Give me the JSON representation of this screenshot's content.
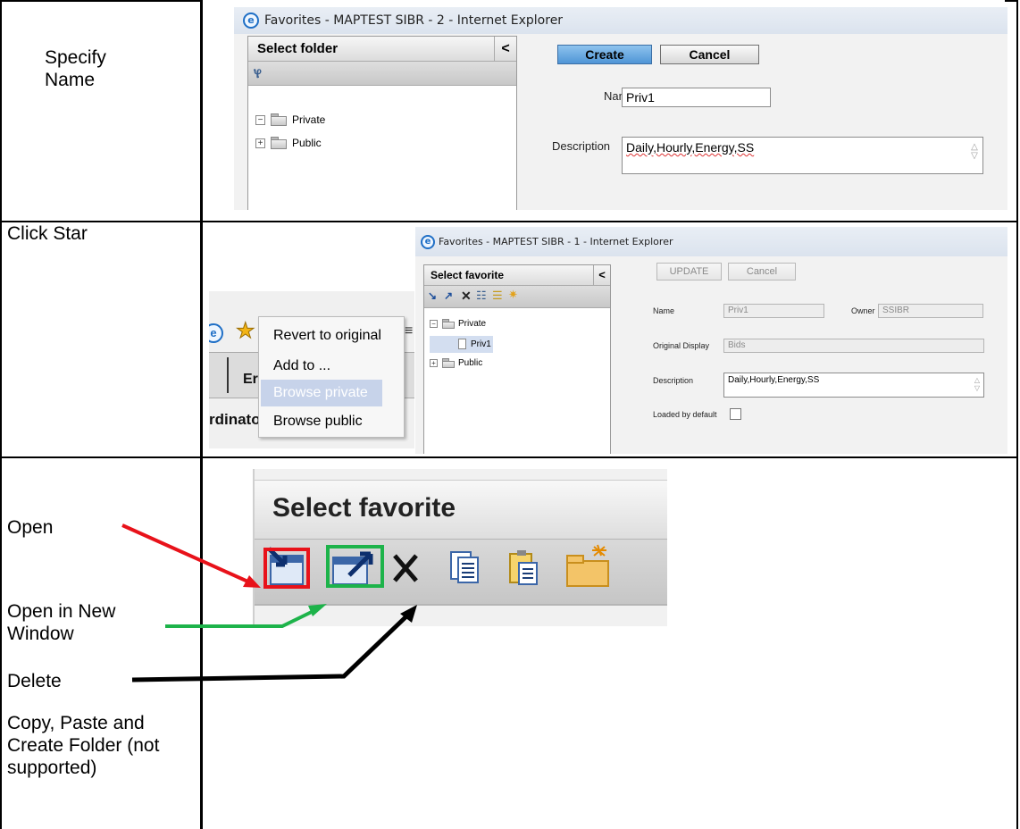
{
  "rows": [
    {
      "label": "Specify Name"
    },
    {
      "label": "Click Star"
    },
    {
      "labels": {
        "open": "Open",
        "open_new_window": "Open in New Window",
        "delete": "Delete",
        "other": "Copy, Paste and Create Folder (not supported)"
      }
    }
  ],
  "shot1": {
    "title": "Favorites - MAPTEST SIBR - 2 - Internet Explorer",
    "panel_title": "Select folder",
    "collapse": "<",
    "tree": [
      {
        "toggle": "−",
        "label": "Private"
      },
      {
        "toggle": "+",
        "label": "Public"
      }
    ],
    "create_button": "Create",
    "cancel_button": "Cancel",
    "name_label": "Name",
    "name_value": "Priv1",
    "description_label": "Description",
    "description_value": "Daily,Hourly,Energy,SS"
  },
  "shot2": {
    "menu_items": [
      "Revert to original",
      "Add to ...",
      "Browse private",
      "Browse public"
    ],
    "bg_text_1": "Er",
    "bg_text_2": "rdinato",
    "title": "Favorites - MAPTEST SIBR - 1 - Internet Explorer",
    "panel_title": "Select favorite",
    "collapse": "<",
    "tree": [
      {
        "toggle": "−",
        "label": "Private"
      },
      {
        "label": "Priv1"
      },
      {
        "toggle": "+",
        "label": "Public"
      }
    ],
    "update_button": "UPDATE",
    "cancel_button": "Cancel",
    "name_label": "Name",
    "name_value": "Priv1",
    "owner_label": "Owner",
    "owner_value": "SSIBR",
    "original_display_label": "Original Display",
    "original_display_value": "Bids",
    "description_label": "Description",
    "description_value": "Daily,Hourly,Energy,SS",
    "loaded_label": "Loaded by default"
  },
  "shot3": {
    "panel_title": "Select favorite"
  },
  "colors": {
    "open_highlight": "#e8121a",
    "new_window_highlight": "#1db34a",
    "delete_arrow": "#000000",
    "menu_selected_bg": "#c7d3ea"
  },
  "icons": [
    "open-icon",
    "open-new-window-icon",
    "delete-icon",
    "copy-icon",
    "paste-icon",
    "create-folder-icon"
  ]
}
